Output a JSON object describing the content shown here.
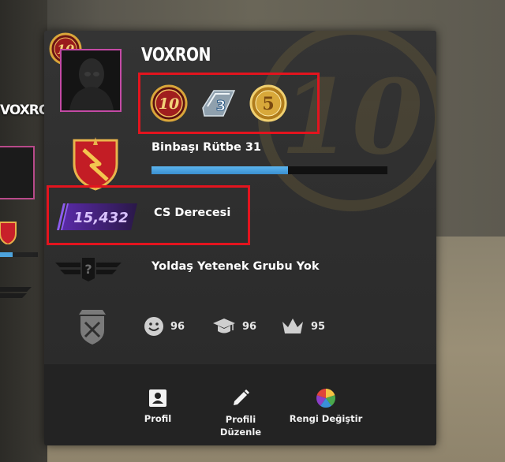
{
  "background": {
    "player_name": "VOXRON"
  },
  "profile": {
    "player_name": "VOXRON",
    "level": "10",
    "medals": [
      {
        "icon": "level-10-medal-icon",
        "label": "10"
      },
      {
        "icon": "service-medal-3-icon",
        "label": "3"
      },
      {
        "icon": "five-year-coin-icon",
        "label": "5"
      }
    ],
    "rank": {
      "label": "Binbaşı Rütbe 31",
      "xp_progress": 0.58
    },
    "cs_rating": {
      "value": "15,432",
      "label": "CS Derecesi"
    },
    "wingman": {
      "label": "Yoldaş Yetenek Grubu Yok"
    },
    "commendations": {
      "friendly": "96",
      "teacher": "96",
      "leader": "95"
    }
  },
  "actions": [
    {
      "icon": "profile-icon",
      "label": "Profil"
    },
    {
      "icon": "edit-pencil-icon",
      "label": "Profili\nDüzenle"
    },
    {
      "icon": "color-wheel-icon",
      "label": "Rengi Değiştir"
    }
  ],
  "colors": {
    "highlight_border": "#e3141e",
    "avatar_border": "#c44aa5",
    "xp_bar": "#4da3dc",
    "premier_purple": "#7a3bd6"
  }
}
